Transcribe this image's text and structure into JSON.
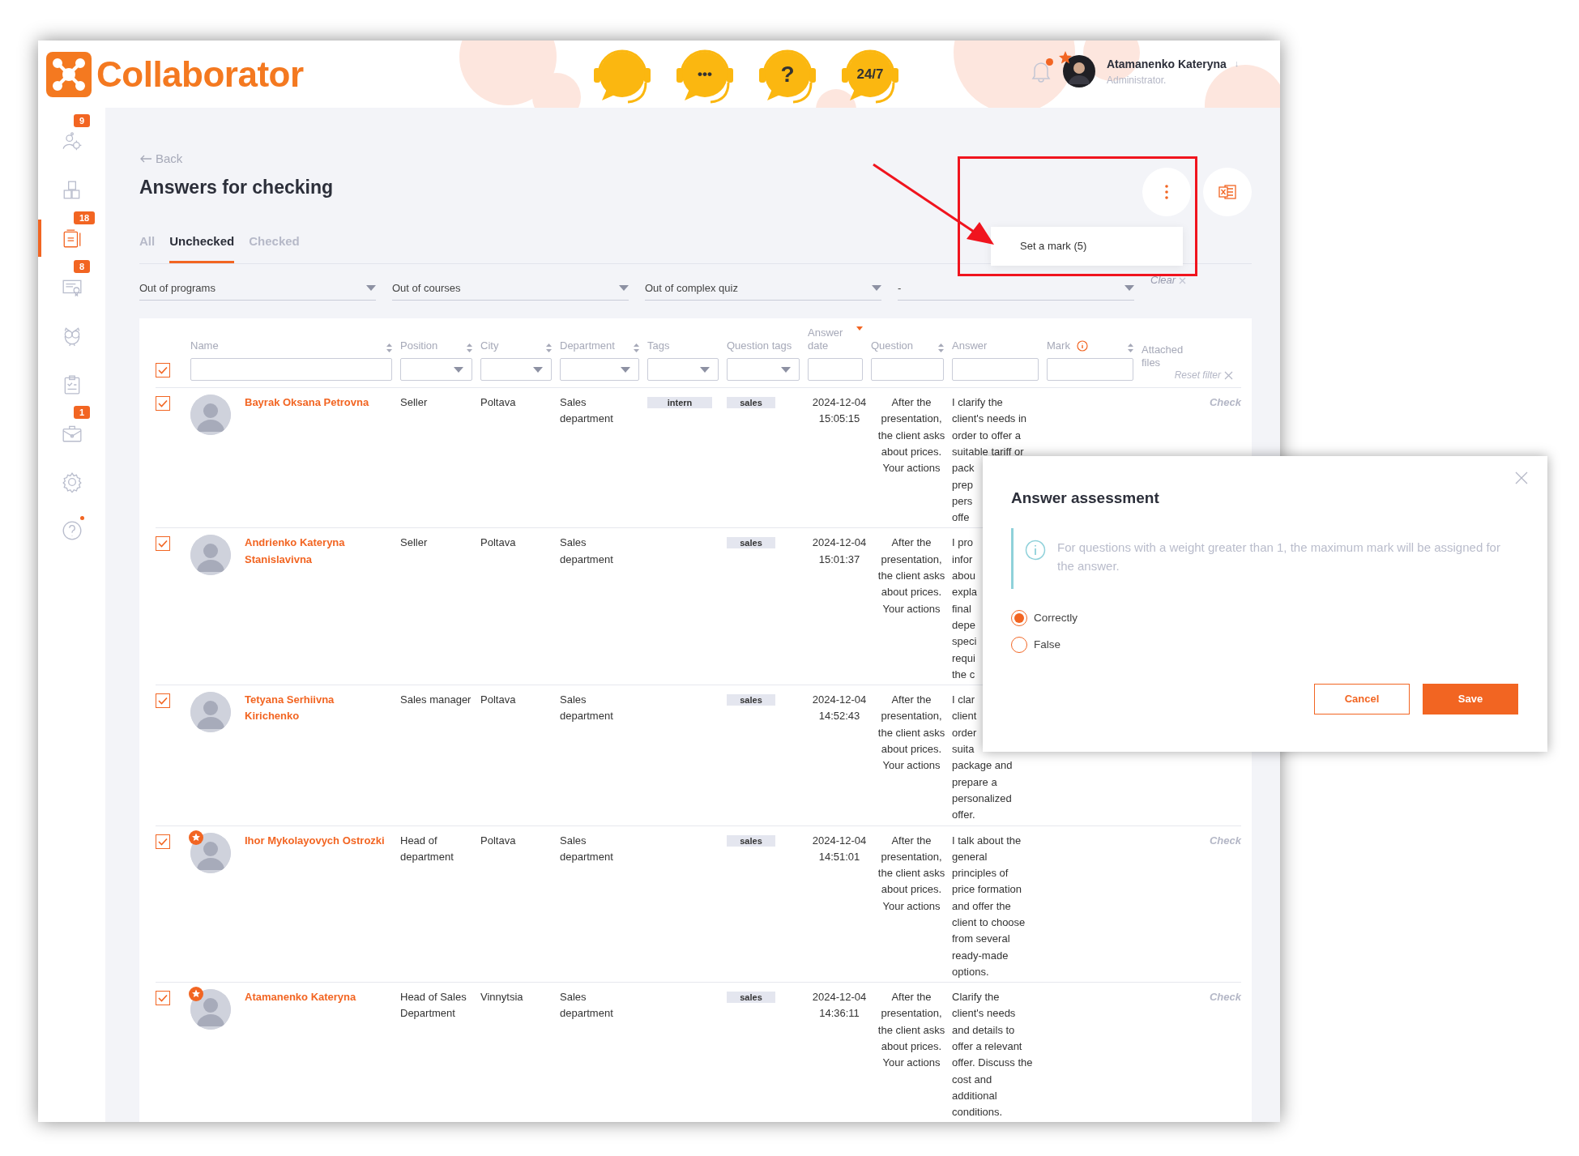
{
  "header": {
    "logo": "Collaborator",
    "support_buttons": [
      {
        "kind": "blank"
      },
      {
        "kind": "text",
        "label": "•••"
      },
      {
        "kind": "text",
        "label": "?"
      },
      {
        "kind": "text",
        "label": "24/7"
      }
    ],
    "notifications": {
      "unread": true
    },
    "user": {
      "name": "Atamanenko Kateryna",
      "role": "Administrator.",
      "caret": "↓",
      "starred": true
    }
  },
  "sidebar": {
    "items": [
      {
        "kind": "team",
        "badge": "9",
        "selected": false,
        "dot": false
      },
      {
        "kind": "abc",
        "selected": false,
        "dot": false
      },
      {
        "kind": "notebook",
        "badge": "18",
        "selected": true,
        "dot": false
      },
      {
        "kind": "certificate",
        "badge": "8",
        "selected": false,
        "dot": false
      },
      {
        "kind": "owl",
        "selected": false,
        "dot": false
      },
      {
        "kind": "clipboard",
        "selected": false,
        "dot": false
      },
      {
        "kind": "briefcase",
        "badge": "1",
        "selected": false,
        "dot": false
      },
      {
        "kind": "gear",
        "selected": false,
        "dot": false
      },
      {
        "kind": "help",
        "selected": false,
        "dot": true
      }
    ]
  },
  "back": "Back",
  "title": "Answers for checking",
  "tabs": [
    {
      "label": "All",
      "selected": false
    },
    {
      "label": "Unchecked",
      "selected": true
    },
    {
      "label": "Checked",
      "selected": false
    }
  ],
  "filters": [
    {
      "label": "Out of programs"
    },
    {
      "label": "Out of courses"
    },
    {
      "label": "Out of complex quiz"
    },
    {
      "label": "-"
    }
  ],
  "clear": "Clear",
  "menu": {
    "items": [
      "Set a mark (5)"
    ]
  },
  "table": {
    "select_all_checked": true,
    "reset_filter": "Reset filter",
    "columns": [
      {
        "label": "Name",
        "kind": "text",
        "sortable": true,
        "sorted": false,
        "info": false
      },
      {
        "label": "Position",
        "kind": "select",
        "sortable": true,
        "sorted": false,
        "info": false
      },
      {
        "label": "City",
        "kind": "select",
        "sortable": true,
        "sorted": false,
        "info": false
      },
      {
        "label": "Department",
        "kind": "select",
        "sortable": true,
        "sorted": false,
        "info": false
      },
      {
        "label": "Tags",
        "kind": "select",
        "sortable": false,
        "sorted": false,
        "info": false
      },
      {
        "label": "Question tags",
        "kind": "select",
        "sortable": false,
        "sorted": false,
        "info": false
      },
      {
        "label": "Answer date",
        "kind": "text",
        "sortable": false,
        "sorted": true,
        "info": false
      },
      {
        "label": "Question",
        "kind": "text",
        "sortable": true,
        "sorted": false,
        "info": false
      },
      {
        "label": "Answer",
        "kind": "text",
        "sortable": false,
        "sorted": false,
        "info": false
      },
      {
        "label": "Mark",
        "kind": "text",
        "sortable": true,
        "sorted": false,
        "info": true
      },
      {
        "label": "Attached files",
        "kind": "plain",
        "sortable": false,
        "sorted": false,
        "info": false
      }
    ],
    "rows": [
      {
        "checked": true,
        "name": "Bayrak Oksana Petrovna",
        "starred": false,
        "position": "Seller",
        "city": "Poltava",
        "department": "Sales department",
        "tags": [
          "intern"
        ],
        "question_tags": [
          "sales"
        ],
        "date": "2024-12-04",
        "time": "15:05:15",
        "question": "After the presentation, the client asks about prices. Your actions",
        "answer": [
          "I clarify the",
          "client's needs in",
          "order to offer a",
          "suitable tariff or",
          "pack",
          "prep",
          "pers",
          "offe"
        ],
        "check": "Check"
      },
      {
        "checked": true,
        "name": "Andrienko Kateryna Stanislavivna",
        "starred": false,
        "position": "Seller",
        "city": "Poltava",
        "department": "Sales department",
        "tags": [],
        "question_tags": [
          "sales"
        ],
        "date": "2024-12-04",
        "time": "15:01:37",
        "question": "After the presentation, the client asks about prices. Your actions",
        "answer": [
          "I pro",
          "infor",
          "abou",
          "expla",
          "final",
          "depe",
          "speci",
          "requi",
          "the c"
        ],
        "check": null
      },
      {
        "checked": true,
        "name": "Tetyana Serhiivna Kirichenko",
        "starred": false,
        "position": "Sales manager",
        "city": "Poltava",
        "department": "Sales department",
        "tags": [],
        "question_tags": [
          "sales"
        ],
        "date": "2024-12-04",
        "time": "14:52:43",
        "question": "After the presentation, the client asks about prices. Your actions",
        "answer": [
          "I clar",
          "client",
          "order",
          "suita",
          "package and",
          "prepare a",
          "personalized",
          "offer."
        ],
        "check": null
      },
      {
        "checked": true,
        "name": "Ihor Mykolayovych Ostrozki",
        "starred": true,
        "position": "Head of department",
        "city": "Poltava",
        "department": "Sales department",
        "tags": [],
        "question_tags": [
          "sales"
        ],
        "date": "2024-12-04",
        "time": "14:51:01",
        "question": "After the presentation, the client asks about prices. Your actions",
        "answer": [
          "I talk about the",
          "general",
          "principles of",
          "price formation",
          "and offer the",
          "client to choose",
          "from several",
          "ready-made",
          "options."
        ],
        "check": "Check"
      },
      {
        "checked": true,
        "name": "Atamanenko Kateryna",
        "starred": true,
        "position": "Head of Sales Department",
        "city": "Vinnytsia",
        "department": "Sales department",
        "tags": [],
        "question_tags": [
          "sales"
        ],
        "date": "2024-12-04",
        "time": "14:36:11",
        "question": "After the presentation, the client asks about prices. Your actions",
        "answer": [
          "Clarify the",
          "client's needs",
          "and details to",
          "offer a relevant",
          "offer. Discuss the",
          "cost and",
          "additional",
          "conditions."
        ],
        "check": "Check"
      }
    ]
  },
  "modal": {
    "title": "Answer assessment",
    "info": "For questions with a weight greater than 1, the maximum mark will be assigned for the answer.",
    "options": [
      {
        "label": "Correctly",
        "selected": true
      },
      {
        "label": "False",
        "selected": false
      }
    ],
    "buttons": [
      {
        "label": "Cancel",
        "kind": "secondary"
      },
      {
        "label": "Save",
        "kind": "primary"
      }
    ]
  }
}
